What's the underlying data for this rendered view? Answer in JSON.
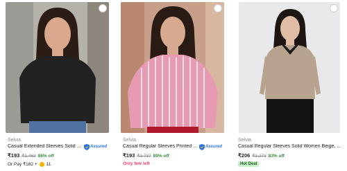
{
  "products": [
    {
      "brand": "Selvia",
      "title": "Casual Extended Sleeves Solid ...",
      "assured_label": "Assured",
      "price": "₹193",
      "mrp": "₹1,463",
      "discount": "86% off",
      "pay_text": "Or Pay ₹182 +",
      "coin_count": "11",
      "image_colors": {
        "top": "#222222",
        "bg": "#b4b2ab",
        "skin": "#d9a88c",
        "hair": "#2b1c16"
      }
    },
    {
      "brand": "Selvia",
      "title": "Casual Regular Sleeves Printed ...",
      "assured_label": "Assured",
      "price": "₹193",
      "mrp": "₹1,737",
      "discount": "89% off",
      "badge": "Only few left",
      "image_colors": {
        "top": "#e79bb2",
        "bg": "#c8a08a",
        "skin": "#d7a98e",
        "hair": "#2a1a14"
      }
    },
    {
      "brand": "Selvia",
      "title": "Casual Regular Sleeves Solid Women Beige, ...",
      "price": "₹206",
      "mrp": "₹1,273",
      "discount": "83% off",
      "badge": "Hot Deal",
      "image_colors": {
        "top": "#b8a48e",
        "bg": "#e9e9eb",
        "skin": "#e2bda5",
        "hair": "#1e1612"
      }
    }
  ]
}
